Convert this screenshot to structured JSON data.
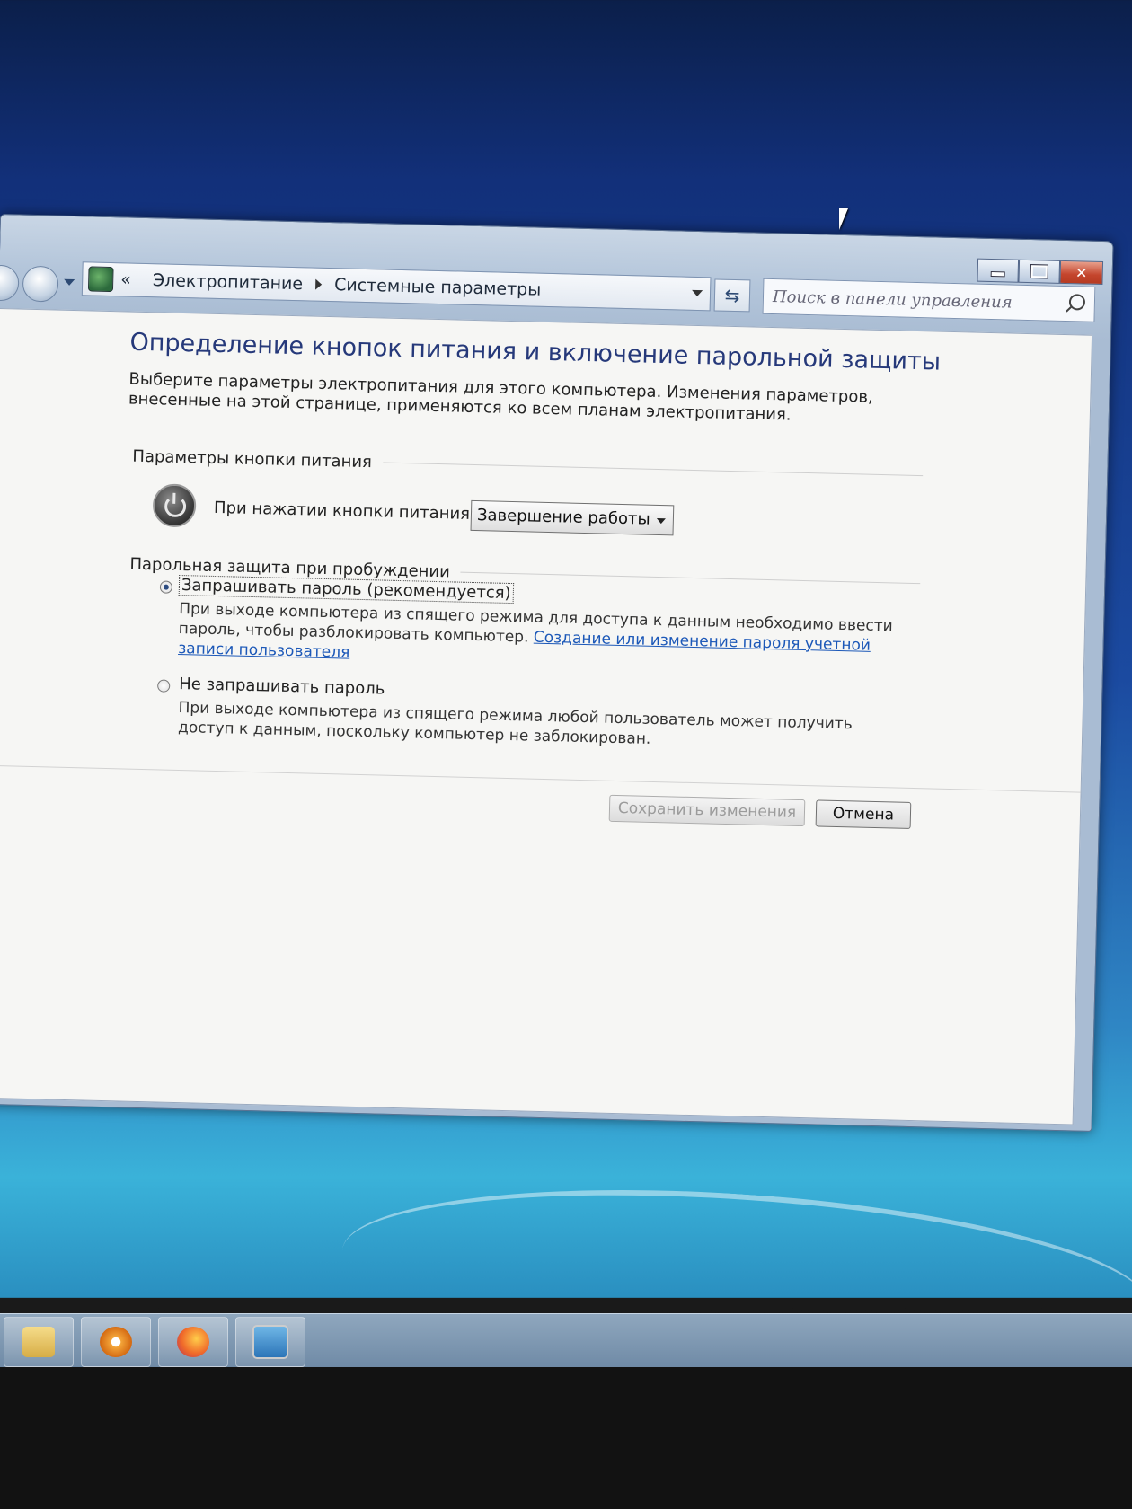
{
  "window": {
    "breadcrumb": {
      "overflow": "«",
      "item1": "Электропитание",
      "item2": "Системные параметры"
    },
    "search_placeholder": "Поиск в панели управления",
    "caption": {
      "minimize": "minimize-icon",
      "maximize": "maximize-icon",
      "close": "✕"
    }
  },
  "page": {
    "title": "Определение кнопок питания и включение парольной защиты",
    "description": "Выберите параметры электропитания для этого компьютера. Изменения параметров, внесенные на этой странице, применяются ко всем планам электропитания.",
    "power_group": {
      "heading": "Параметры кнопки питания",
      "label": "При нажатии кнопки питания:",
      "selected": "Завершение работы"
    },
    "password_group": {
      "heading": "Парольная защита при пробуждении",
      "option1": {
        "label": "Запрашивать пароль (рекомендуется)",
        "description": "При выходе компьютера из спящего режима для доступа к данным необходимо ввести пароль, чтобы разблокировать компьютер.",
        "link": "Создание или изменение пароля учетной записи пользователя",
        "selected": true
      },
      "option2": {
        "label": "Не запрашивать пароль",
        "description": "При выходе компьютера из спящего режима любой пользователь может получить доступ к данным, поскольку компьютер не заблокирован.",
        "selected": false
      }
    },
    "buttons": {
      "save": "Сохранить изменения",
      "cancel": "Отмена"
    }
  },
  "taskbar": {
    "items": [
      "folder-icon",
      "media-player-icon",
      "firefox-icon",
      "monitor-icon"
    ]
  },
  "colors": {
    "title": "#26397a",
    "link": "#1c58b8",
    "close_button": "#c4452d"
  }
}
